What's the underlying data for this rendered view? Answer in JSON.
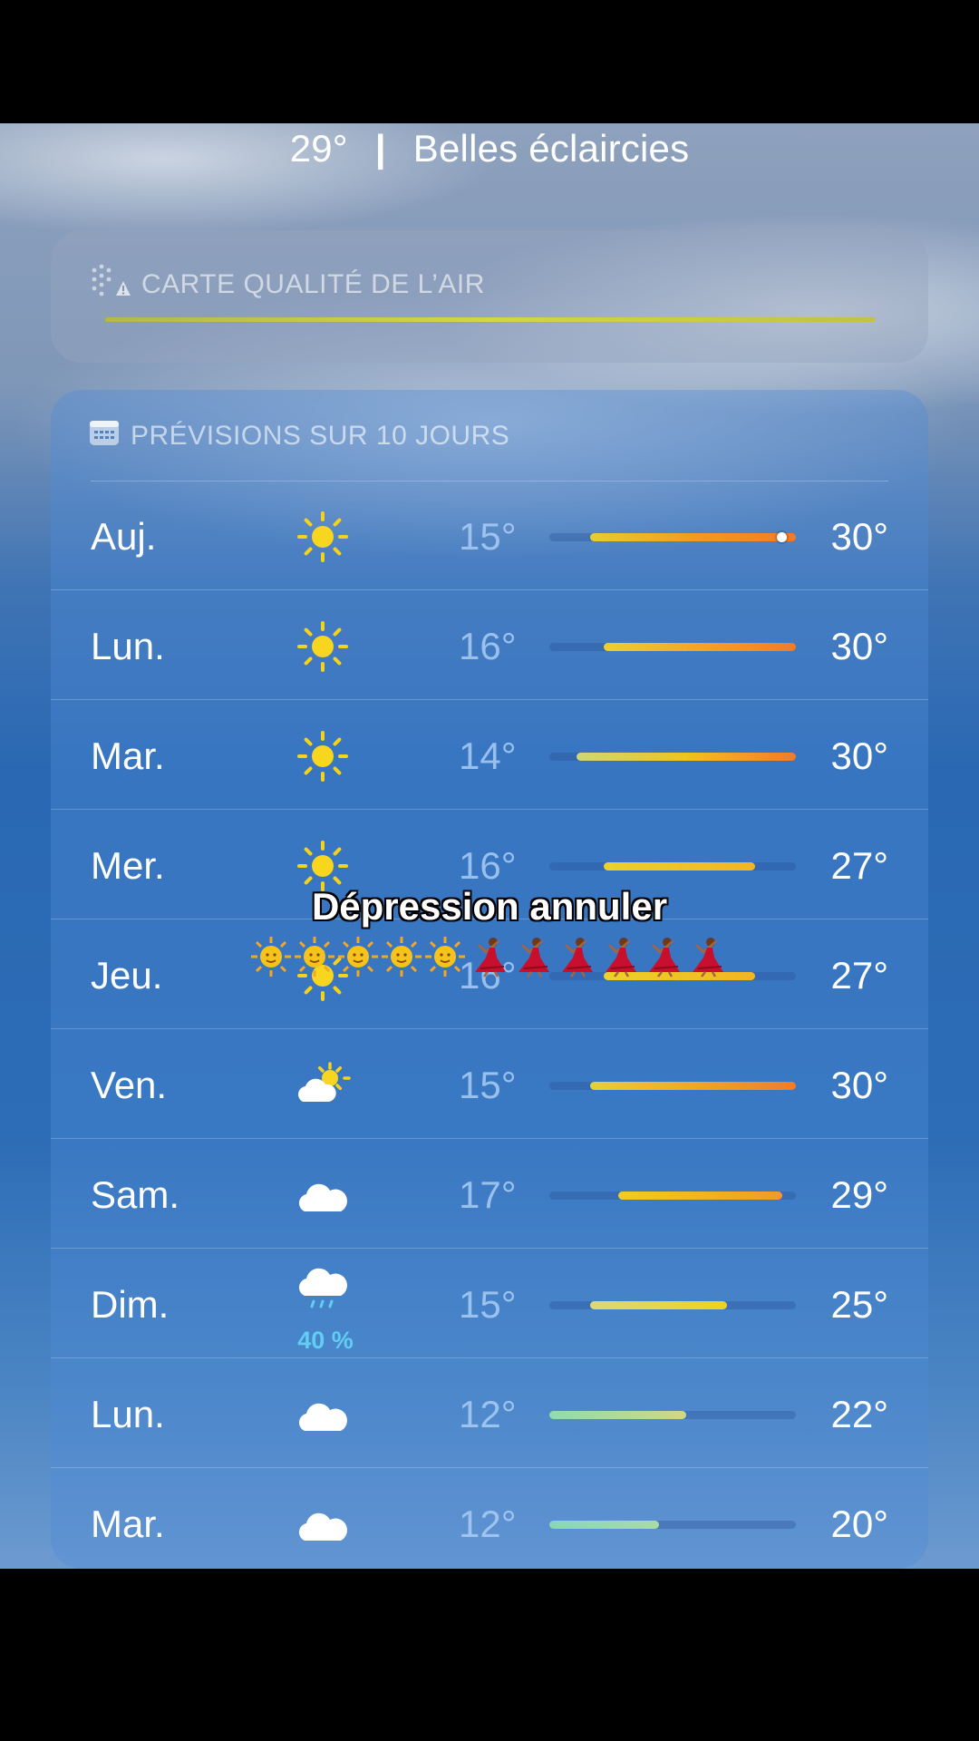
{
  "header": {
    "temp": "29°",
    "separator": "|",
    "condition": "Belles éclaircies"
  },
  "air_quality": {
    "title": "CARTE QUALITÉ DE L’AIR",
    "icon": "air-quality-icon"
  },
  "forecast": {
    "title": "PRÉVISIONS SUR 10 JOURS",
    "icon": "calendar-icon",
    "range_min": 12,
    "range_max": 30,
    "rows": [
      {
        "day": "Auj.",
        "icon": "sun",
        "lo": "15°",
        "hi": "30°",
        "lo_val": 15,
        "hi_val": 30,
        "now": 29,
        "colors": [
          "#e7cf2d",
          "#f59a1f",
          "#f07b2a"
        ]
      },
      {
        "day": "Lun.",
        "icon": "sun",
        "lo": "16°",
        "hi": "30°",
        "lo_val": 16,
        "hi_val": 30,
        "colors": [
          "#ecd12b",
          "#f3a524",
          "#f07b2a"
        ]
      },
      {
        "day": "Mar.",
        "icon": "sun",
        "lo": "14°",
        "hi": "30°",
        "lo_val": 14,
        "hi_val": 30,
        "colors": [
          "#cfd67a",
          "#f2c21e",
          "#f07b2a"
        ]
      },
      {
        "day": "Mer.",
        "icon": "sun",
        "lo": "16°",
        "hi": "27°",
        "lo_val": 16,
        "hi_val": 27,
        "colors": [
          "#ecd12b",
          "#f2b523"
        ]
      },
      {
        "day": "Jeu.",
        "icon": "sun",
        "lo": "16°",
        "hi": "27°",
        "lo_val": 16,
        "hi_val": 27,
        "colors": [
          "#ecd12b",
          "#f2b523"
        ]
      },
      {
        "day": "Ven.",
        "icon": "sun-cloud",
        "lo": "15°",
        "hi": "30°",
        "lo_val": 15,
        "hi_val": 30,
        "colors": [
          "#e2d23a",
          "#f4a623",
          "#f07b2a"
        ]
      },
      {
        "day": "Sam.",
        "icon": "cloud",
        "lo": "17°",
        "hi": "29°",
        "lo_val": 17,
        "hi_val": 29,
        "colors": [
          "#f1cd1f",
          "#f39a26"
        ]
      },
      {
        "day": "Dim.",
        "icon": "rain",
        "pct": "40 %",
        "lo": "15°",
        "hi": "25°",
        "lo_val": 15,
        "hi_val": 25,
        "colors": [
          "#dcd976",
          "#eed21f"
        ]
      },
      {
        "day": "Lun.",
        "icon": "cloud",
        "lo": "12°",
        "hi": "22°",
        "lo_val": 12,
        "hi_val": 22,
        "colors": [
          "#8fdcb0",
          "#cfd97e"
        ]
      },
      {
        "day": "Mar.",
        "icon": "cloud",
        "lo": "12°",
        "hi": "20°",
        "lo_val": 12,
        "hi_val": 20,
        "colors": [
          "#86d7b8",
          "#a9dca4"
        ]
      }
    ]
  },
  "overlay": {
    "caption": "Dépression annuler",
    "emojis": [
      "sun-face-emoji",
      "sun-face-emoji",
      "sun-face-emoji",
      "sun-face-emoji",
      "sun-face-emoji",
      "dancer-emoji",
      "dancer-emoji",
      "dancer-emoji",
      "dancer-emoji",
      "dancer-emoji",
      "dancer-emoji"
    ]
  }
}
